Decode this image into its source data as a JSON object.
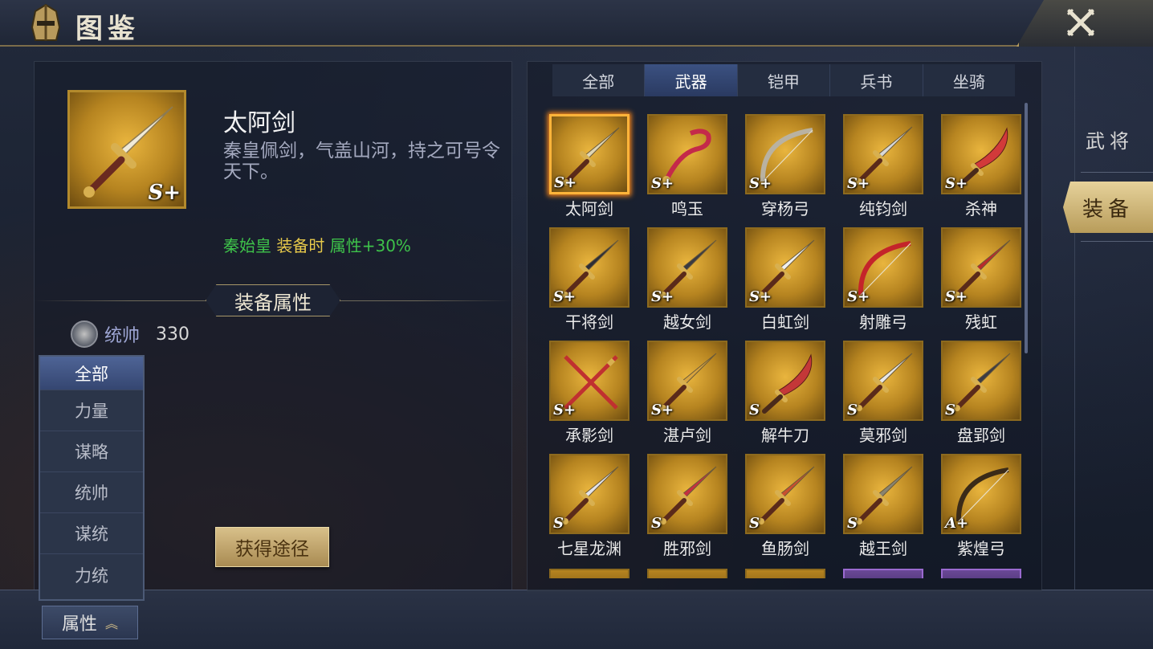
{
  "header": {
    "title": "图鉴"
  },
  "detail": {
    "item_name": "太阿剑",
    "grade": "S+",
    "description": "秦皇佩剑，气盖山河，持之可号令天下。",
    "bonus_hero": "秦始皇",
    "bonus_condition": "装备时",
    "bonus_effect": "属性+30%",
    "attr_header": "装备属性",
    "stat_label": "统帅",
    "stat_value": "330",
    "obtain_button": "获得途径"
  },
  "filter": {
    "items": [
      "全部",
      "力量",
      "谋略",
      "统帅",
      "谋统",
      "力统"
    ],
    "toggle_label": "属性",
    "toggle_arrow": "︽"
  },
  "tabs": [
    "全部",
    "武器",
    "铠甲",
    "兵书",
    "坐骑"
  ],
  "active_tab": "武器",
  "side_tabs": {
    "inactive": "武将",
    "active": "装备"
  },
  "items": [
    {
      "name": "太阿剑",
      "grade": "S+",
      "icon": "sword-icon",
      "color": "#e0d6b4"
    },
    {
      "name": "鸣玉",
      "grade": "S+",
      "icon": "whip-icon",
      "color": "#c4294a"
    },
    {
      "name": "穿杨弓",
      "grade": "S+",
      "icon": "bow-icon",
      "color": "#b9b2a2"
    },
    {
      "name": "纯钧剑",
      "grade": "S+",
      "icon": "sword-icon",
      "color": "#d8d8d8"
    },
    {
      "name": "杀神",
      "grade": "S+",
      "icon": "saber-icon",
      "color": "#d23a3a"
    },
    {
      "name": "干将剑",
      "grade": "S+",
      "icon": "sword-icon",
      "color": "#2e2e36"
    },
    {
      "name": "越女剑",
      "grade": "S+",
      "icon": "sword-icon",
      "color": "#3a3a42"
    },
    {
      "name": "白虹剑",
      "grade": "S+",
      "icon": "sword-icon",
      "color": "#f0f0f0"
    },
    {
      "name": "射雕弓",
      "grade": "S+",
      "icon": "bow-icon",
      "color": "#c4242a"
    },
    {
      "name": "残虹",
      "grade": "S+",
      "icon": "sword-icon",
      "color": "#b82c2c"
    },
    {
      "name": "承影剑",
      "grade": "S+",
      "icon": "crossed-swords-icon",
      "color": "#c03030"
    },
    {
      "name": "湛卢剑",
      "grade": "S+",
      "icon": "sword-icon",
      "color": "#d9a43e"
    },
    {
      "name": "解牛刀",
      "grade": "S",
      "icon": "saber-icon",
      "color": "#c43838"
    },
    {
      "name": "莫邪剑",
      "grade": "S",
      "icon": "sword-icon",
      "color": "#e8e8e8"
    },
    {
      "name": "盘郢剑",
      "grade": "S",
      "icon": "sword-icon",
      "color": "#3c3c44"
    },
    {
      "name": "七星龙渊",
      "grade": "S",
      "icon": "sword-icon",
      "color": "#e4e4ea"
    },
    {
      "name": "胜邪剑",
      "grade": "S",
      "icon": "sword-icon",
      "color": "#c43040"
    },
    {
      "name": "鱼肠剑",
      "grade": "S",
      "icon": "sword-icon",
      "color": "#c85030"
    },
    {
      "name": "越王剑",
      "grade": "S",
      "icon": "sword-icon",
      "color": "#8a8470"
    },
    {
      "name": "紫煌弓",
      "grade": "A+",
      "icon": "bow-icon",
      "color": "#3a2a18"
    }
  ],
  "partial_row": [
    "gold",
    "gold",
    "gold",
    "purple",
    "purple"
  ]
}
